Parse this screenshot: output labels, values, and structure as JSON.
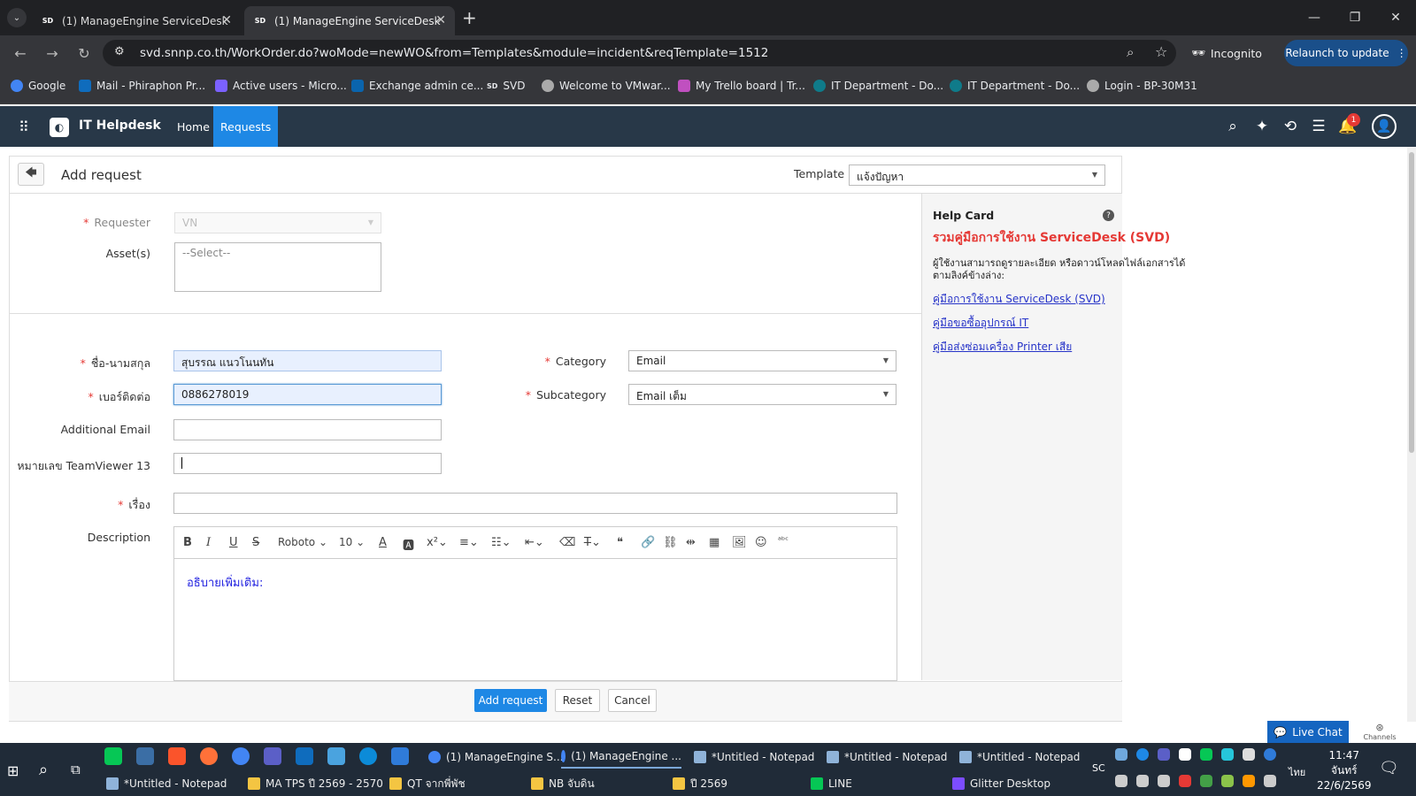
{
  "browser": {
    "tabs": [
      {
        "icon": "SD",
        "title": "(1) ManageEngine ServiceDesk"
      },
      {
        "icon": "SD",
        "title": "(1) ManageEngine ServiceDesk"
      }
    ],
    "url": "svd.snnp.co.th/WorkOrder.do?woMode=newWO&from=Templates&module=incident&reqTemplate=1512",
    "incognito_label": "Incognito",
    "relaunch_label": "Relaunch to update",
    "bookmarks": [
      "Google",
      "Mail - Phiraphon Pr...",
      "Active users - Micro...",
      "Exchange admin ce...",
      "SVD",
      "Welcome to VMwar...",
      "My Trello board | Tr...",
      "IT Department - Do...",
      "IT Department - Do...",
      "Login - BP-30M31"
    ]
  },
  "app": {
    "name": "IT Helpdesk",
    "nav": [
      "Home",
      "Requests"
    ],
    "notification_count": "1"
  },
  "form": {
    "title": "Add request",
    "template_label": "Template",
    "template_value": "แจ้งปัญหา",
    "requester_label": "Requester",
    "requester_value": "VN",
    "assets_label": "Asset(s)",
    "assets_placeholder": "--Select--",
    "name_label": "ชื่อ-นามสกุล",
    "name_value": "สุบรรณ  แนวโนนทัน",
    "phone_label": "เบอร์ติดต่อ",
    "phone_value": "0886278019",
    "additional_email_label": "Additional Email",
    "teamviewer_label": "หมายเลข TeamViewer 13",
    "category_label": "Category",
    "category_value": "Email",
    "subcategory_label": "Subcategory",
    "subcategory_value": "Email เต็ม",
    "subject_label": "เรื่อง",
    "description_label": "Description",
    "description_value": "อธิบายเพิ่มเติม:",
    "editor_font": "Roboto",
    "editor_size": "10"
  },
  "help": {
    "title": "Help Card",
    "headline": "รวมคู่มือการใช้งาน  ServiceDesk (SVD)",
    "text_line1": "ผู้ใช้งานสามารถดูรายละเอียด หรือดาวน์โหลดไฟล์เอกสารได้",
    "text_line2": "ตามลิงค์ข้างล่าง:",
    "links": [
      "คู่มือการใช้งาน ServiceDesk (SVD)",
      "คู่มือขอซื้ออุปกรณ์ IT",
      "คู่มือส่งซ่อมเครื่อง Printer เสีย"
    ],
    "headline_color": "#e53935"
  },
  "buttons": {
    "add": "Add request",
    "reset": "Reset",
    "cancel": "Cancel"
  },
  "chat": {
    "live_chat": "Live Chat",
    "channels": "Channels"
  },
  "taskbar": {
    "row1": [
      "(1) ManageEngine S...",
      "(1) ManageEngine ...",
      "*Untitled - Notepad",
      "*Untitled - Notepad",
      "*Untitled - Notepad"
    ],
    "row2": [
      "*Untitled - Notepad",
      "MA TPS ปี 2569 - 2570",
      "QT จากพี่พัช",
      "NB จับดิน",
      "ปี 2569",
      "LINE",
      "Glitter Desktop"
    ],
    "tray_label": "SC",
    "lang": "ไทย",
    "time": "11:47",
    "day": "จันทร์",
    "date": "22/6/2569"
  }
}
